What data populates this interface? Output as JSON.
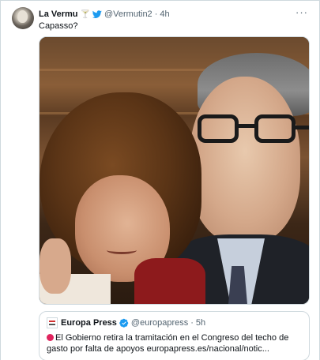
{
  "tweet": {
    "author_name": "La Vermu",
    "author_emoji": "🍸",
    "author_handle": "@Vermutin2",
    "separator": "·",
    "time": "4h",
    "text": "Capasso?",
    "more_label": "···"
  },
  "quoted_tweet": {
    "author_name": "Europa Press",
    "author_handle": "@europapress",
    "separator": "·",
    "time": "5h",
    "text": "El Gobierno retira la tramitación en el Congreso del techo de gasto por falta de apoyos europapress.es/nacional/notic..."
  },
  "colors": {
    "twitter_blue": "#1d9bf0",
    "border": "#cfd9de",
    "muted_text": "#536471",
    "red_circle": "#e0245e"
  },
  "icons": [
    "twitter-bird-icon",
    "more-options-icon",
    "verified-badge-icon",
    "red-circle-icon"
  ]
}
